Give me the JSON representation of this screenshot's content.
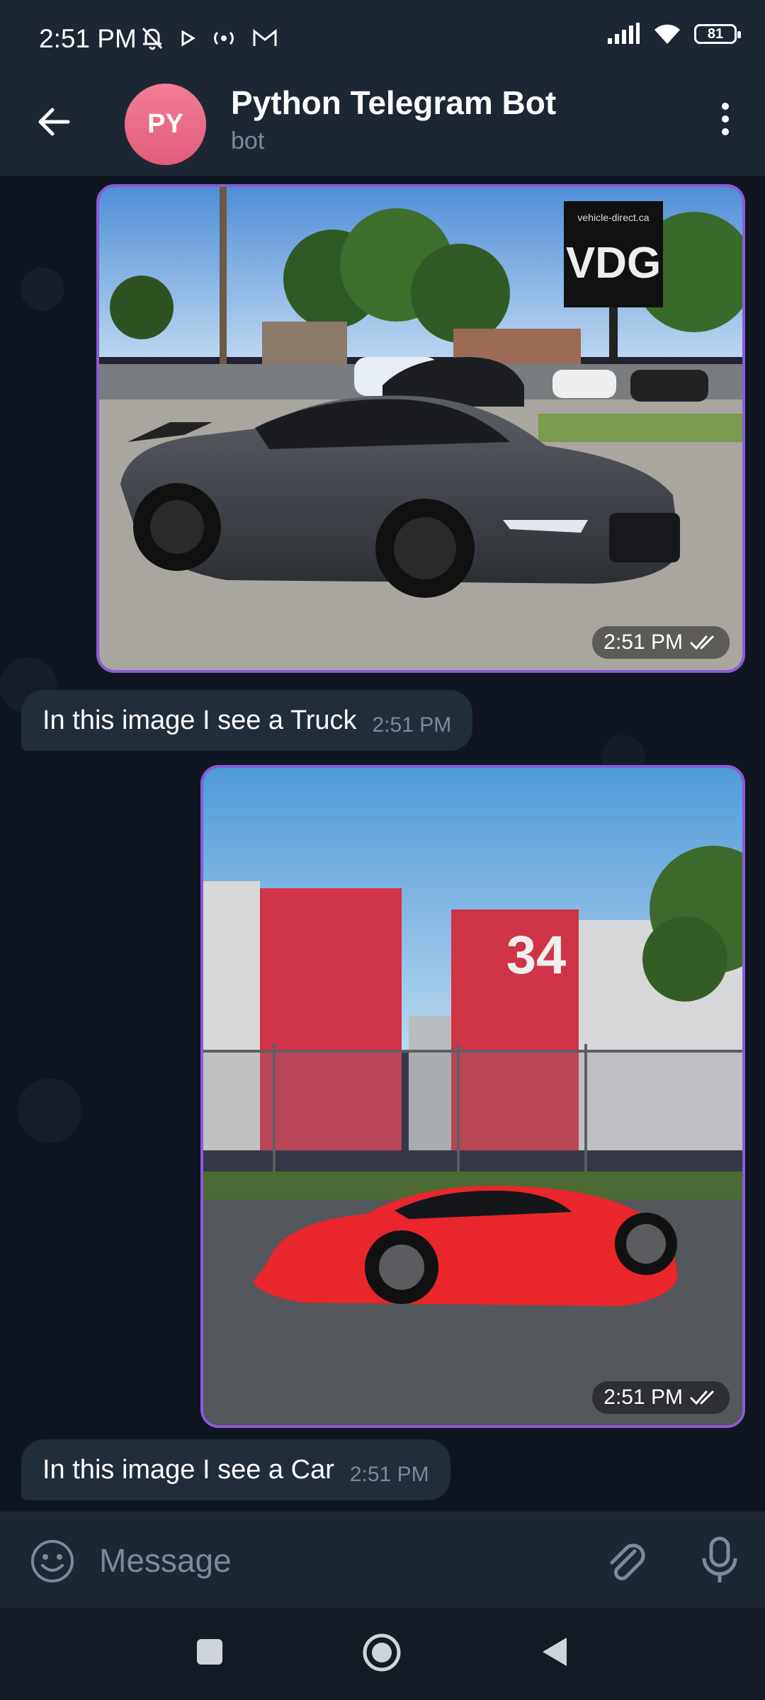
{
  "status_bar": {
    "time": "2:51 PM",
    "battery": "81",
    "icons_left": [
      "mute-bell-icon",
      "play-icon",
      "radio-icon",
      "gmail-icon"
    ],
    "icons_right": [
      "signal-icon",
      "wifi-icon",
      "battery-icon"
    ]
  },
  "header": {
    "avatar_initials": "PY",
    "title": "Python Telegram Bot",
    "subtitle": "bot",
    "avatar_color": "#e8637f"
  },
  "messages": [
    {
      "type": "photo",
      "outgoing": true,
      "time": "2:51 PM",
      "description_icon": "image-sports-car-gray"
    },
    {
      "type": "text",
      "outgoing": false,
      "text": "In this image I see a Truck",
      "time": "2:51 PM"
    },
    {
      "type": "photo",
      "outgoing": true,
      "time": "2:51 PM",
      "description_icon": "image-sports-car-red"
    },
    {
      "type": "text",
      "outgoing": false,
      "text": "In this image I see a Car",
      "time": "2:51 PM"
    }
  ],
  "photo1": {
    "sign_text": "VDG",
    "sign_url": "vehicle-direct.ca"
  },
  "photo2": {
    "building_number": "34"
  },
  "composer": {
    "placeholder": "Message"
  },
  "colors": {
    "accent_border": "#8a5bd6",
    "bubble_bg": "#222d3a",
    "header_bg": "#1d2733",
    "chat_bg": "#0f1621"
  }
}
